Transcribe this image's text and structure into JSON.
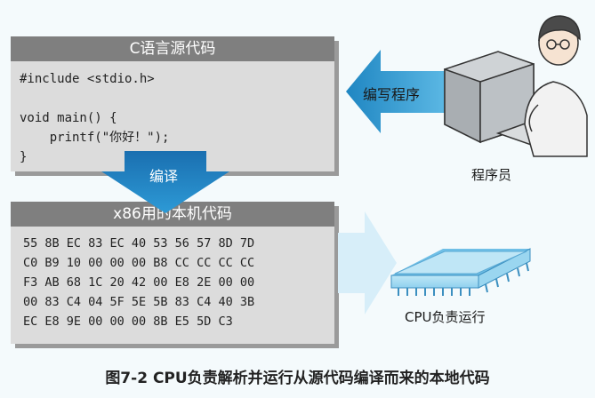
{
  "source_panel": {
    "title": "C语言源代码",
    "code_lines": [
      "#include <stdio.h>",
      "",
      "void main() {",
      "    printf(\"你好！\");",
      "}"
    ]
  },
  "machine_panel": {
    "title": "x86用的本机代码",
    "hex_rows": [
      "55 8B EC 83 EC 40 53 56 57 8D 7D",
      "C0 B9 10 00 00 00 B8 CC CC CC CC",
      "F3 AB 68 1C 20 42 00 E8 2E 00 00",
      "00 83 C4 04 5F 5E 5B 83 C4 40 3B",
      "EC E8 9E 00 00 00 8B E5 5D C3"
    ]
  },
  "arrows": {
    "write": "编写程序",
    "compile": "编译"
  },
  "labels": {
    "programmer": "程序员",
    "cpu": "CPU负责运行"
  },
  "caption": "图7-2 CPU负责解析并运行从源代码编译而来的本地代码"
}
